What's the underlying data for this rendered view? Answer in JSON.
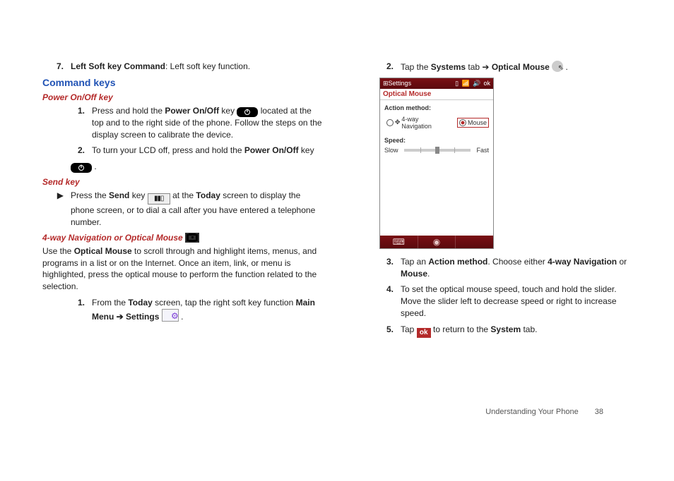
{
  "left": {
    "item7": {
      "n": "7.",
      "term": "Left Soft key Command",
      "rest": ": Left soft key function."
    },
    "h_cmdkeys": "Command keys",
    "h_power": "Power On/Off key",
    "power1": {
      "n": "1.",
      "pre": "Press and hold the ",
      "b1": "Power On/Off",
      "mid": " key ",
      "post": " located at the top and to the right side of the phone. Follow the steps on the display screen to calibrate the device."
    },
    "power2": {
      "n": "2.",
      "pre": "To turn your LCD off, press and hold the ",
      "b1": "Power On/Off",
      "post": " key"
    },
    "h_send": "Send key",
    "send": {
      "pre": "Press the ",
      "b1": "Send",
      "mid1": " key ",
      "mid2": " at the ",
      "b2": "Today",
      "post": " screen to display the phone screen, or to dial a call after you have entered a telephone number."
    },
    "h_nav": "4-way Navigation or Optical Mouse",
    "nav_para": {
      "pre": "Use the ",
      "b1": "Optical Mouse",
      "post": " to scroll through and highlight items, menus, and programs in a list or on the Internet. Once an item, link, or menu is highlighted, press the optical mouse to perform the function related to the selection."
    },
    "nav1": {
      "n": "1.",
      "pre": "From the ",
      "b1": "Today",
      "mid": " screen, tap the right soft key function ",
      "b2": "Main Menu ➔ Settings",
      "post": " ."
    }
  },
  "right": {
    "r2": {
      "n": "2.",
      "pre": "Tap the ",
      "b1": "Systems",
      "mid": " tab ➔ ",
      "b2": "Optical Mouse",
      "post": " ."
    },
    "phone": {
      "wintitle_left": "Settings",
      "wintitle_ok": "ok",
      "tab": "Optical Mouse",
      "action_label": "Action method:",
      "opt1": "4-way Navigation",
      "opt2": "Mouse",
      "speed_label": "Speed:",
      "slow": "Slow",
      "fast": "Fast"
    },
    "r3": {
      "n": "3.",
      "pre": "Tap an ",
      "b1": "Action method",
      "mid": ". Choose either ",
      "b2": "4-way Navigation",
      "or": " or ",
      "b3": "Mouse",
      "post": "."
    },
    "r4": {
      "n": "4.",
      "t": "To set the optical mouse speed, touch and hold the slider. Move the slider left to decrease speed or right to increase speed."
    },
    "r5": {
      "n": "5.",
      "pre": "Tap ",
      "mid": " to return to the ",
      "b1": "System",
      "post": " tab."
    }
  },
  "footer": {
    "section": "Understanding Your Phone",
    "page": "38"
  }
}
